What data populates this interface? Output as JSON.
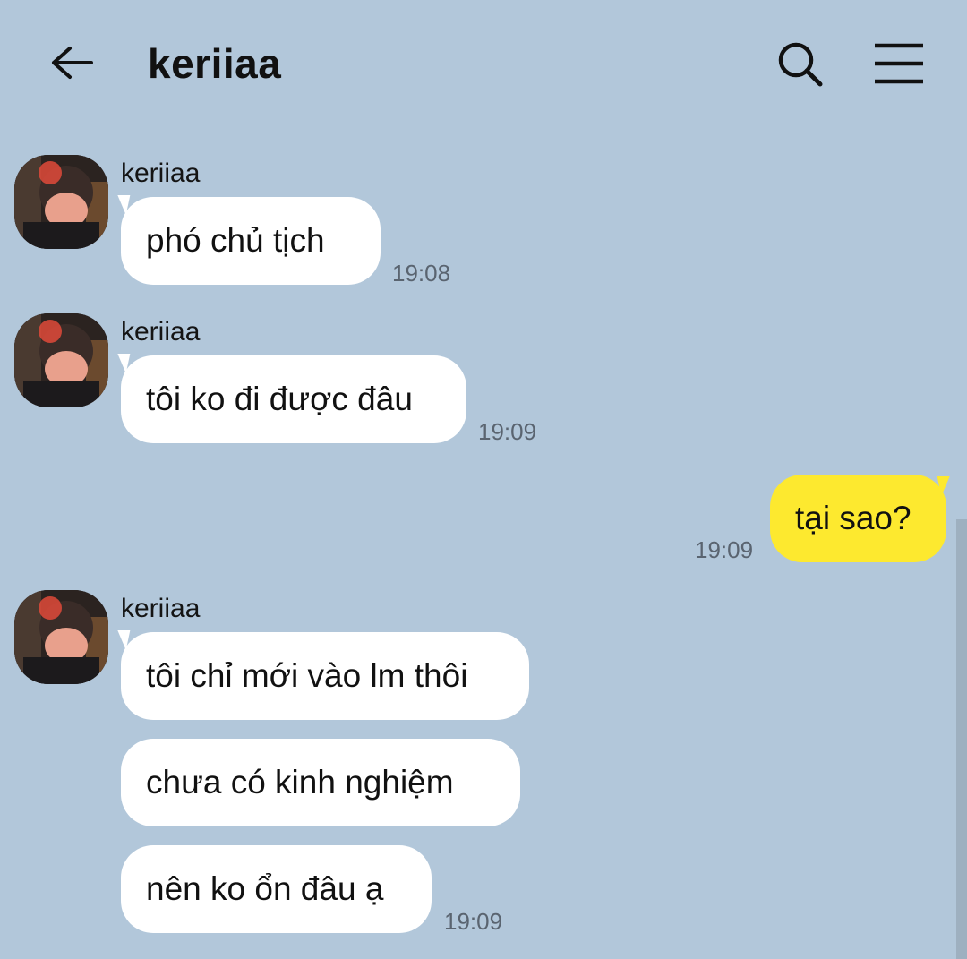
{
  "header": {
    "back_icon": "arrow-left-icon",
    "title": "keriiaa",
    "search_icon": "search-icon",
    "menu_icon": "hamburger-menu-icon"
  },
  "colors": {
    "background": "#b2c7da",
    "incoming_bubble": "#ffffff",
    "outgoing_bubble": "#fde92f",
    "timestamp": "#5a6470"
  },
  "messages": [
    {
      "sender": "keriiaa",
      "text": "phó chủ tịch",
      "time": "19:08"
    },
    {
      "sender": "keriiaa",
      "text": "tôi ko đi được đâu",
      "time": "19:09"
    },
    {
      "sender": "me",
      "text": "tại sao?",
      "time": "19:09"
    },
    {
      "sender": "keriiaa",
      "text": "tôi chỉ mới vào lm thôi"
    },
    {
      "text": "chưa có kinh nghiệm"
    },
    {
      "text": "nên ko ổn đâu ạ",
      "time": "19:09"
    }
  ]
}
